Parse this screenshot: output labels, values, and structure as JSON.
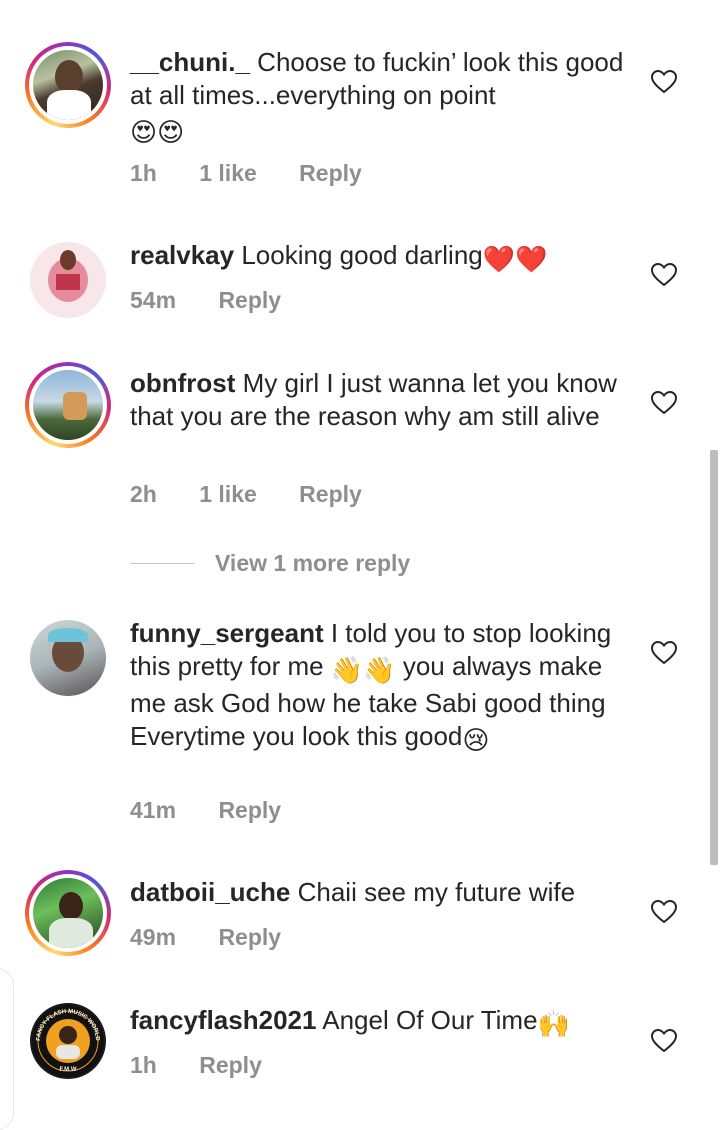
{
  "comments": [
    {
      "username": "__chuni._",
      "text": "Choose to fuckin’ look this good at all times...everything on point",
      "emoji": "😍😍",
      "time": "1h",
      "likes": "1 like",
      "reply": "Reply",
      "story": true
    },
    {
      "username": "realvkay",
      "text": "Looking good darling",
      "emoji": "❤️❤️",
      "time": "54m",
      "reply": "Reply",
      "story": false
    },
    {
      "username": "obnfrost",
      "text": "My girl I just wanna let you know that you are the reason why am still alive",
      "time": "2h",
      "likes": "1 like",
      "reply": "Reply",
      "story": true
    },
    {
      "username": "funny_sergeant",
      "text_parts": [
        "I told you to stop looking this pretty for me ",
        "you always make me ask God how he take Sabi good thing Everytime you look this good"
      ],
      "emoji_a": "👋👋",
      "emoji_b": "😢",
      "time": "41m",
      "reply": "Reply",
      "story": false
    },
    {
      "username": "datboii_uche",
      "text": "Chaii see my future wife",
      "time": "49m",
      "reply": "Reply",
      "story": true
    },
    {
      "username": "fancyflash2021",
      "text": "Angel Of Our Time",
      "emoji": "🙌",
      "time": "1h",
      "reply": "Reply",
      "story": false,
      "avatar_text_top": "FANCY-FLASH MUSIC WORLD",
      "avatar_text_bottom": "F.M.W"
    }
  ],
  "view_more_replies": "View 1 more reply",
  "icons": {
    "like": "heart-outline-icon"
  },
  "colors": {
    "text": "#262626",
    "meta": "#8e8e8e",
    "heart_stroke": "#262626"
  }
}
